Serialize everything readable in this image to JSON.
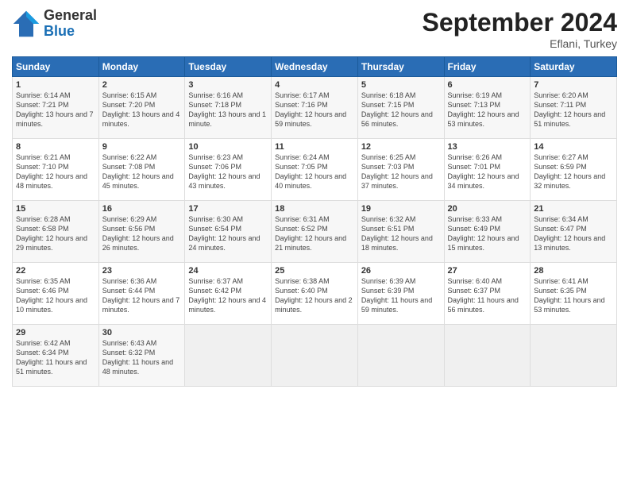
{
  "logo": {
    "general": "General",
    "blue": "Blue"
  },
  "title": "September 2024",
  "location": "Eflani, Turkey",
  "days_of_week": [
    "Sunday",
    "Monday",
    "Tuesday",
    "Wednesday",
    "Thursday",
    "Friday",
    "Saturday"
  ],
  "weeks": [
    [
      {
        "day": "1",
        "sunrise": "6:14 AM",
        "sunset": "7:21 PM",
        "daylight": "13 hours and 7 minutes."
      },
      {
        "day": "2",
        "sunrise": "6:15 AM",
        "sunset": "7:20 PM",
        "daylight": "13 hours and 4 minutes."
      },
      {
        "day": "3",
        "sunrise": "6:16 AM",
        "sunset": "7:18 PM",
        "daylight": "13 hours and 1 minute."
      },
      {
        "day": "4",
        "sunrise": "6:17 AM",
        "sunset": "7:16 PM",
        "daylight": "12 hours and 59 minutes."
      },
      {
        "day": "5",
        "sunrise": "6:18 AM",
        "sunset": "7:15 PM",
        "daylight": "12 hours and 56 minutes."
      },
      {
        "day": "6",
        "sunrise": "6:19 AM",
        "sunset": "7:13 PM",
        "daylight": "12 hours and 53 minutes."
      },
      {
        "day": "7",
        "sunrise": "6:20 AM",
        "sunset": "7:11 PM",
        "daylight": "12 hours and 51 minutes."
      }
    ],
    [
      {
        "day": "8",
        "sunrise": "6:21 AM",
        "sunset": "7:10 PM",
        "daylight": "12 hours and 48 minutes."
      },
      {
        "day": "9",
        "sunrise": "6:22 AM",
        "sunset": "7:08 PM",
        "daylight": "12 hours and 45 minutes."
      },
      {
        "day": "10",
        "sunrise": "6:23 AM",
        "sunset": "7:06 PM",
        "daylight": "12 hours and 43 minutes."
      },
      {
        "day": "11",
        "sunrise": "6:24 AM",
        "sunset": "7:05 PM",
        "daylight": "12 hours and 40 minutes."
      },
      {
        "day": "12",
        "sunrise": "6:25 AM",
        "sunset": "7:03 PM",
        "daylight": "12 hours and 37 minutes."
      },
      {
        "day": "13",
        "sunrise": "6:26 AM",
        "sunset": "7:01 PM",
        "daylight": "12 hours and 34 minutes."
      },
      {
        "day": "14",
        "sunrise": "6:27 AM",
        "sunset": "6:59 PM",
        "daylight": "12 hours and 32 minutes."
      }
    ],
    [
      {
        "day": "15",
        "sunrise": "6:28 AM",
        "sunset": "6:58 PM",
        "daylight": "12 hours and 29 minutes."
      },
      {
        "day": "16",
        "sunrise": "6:29 AM",
        "sunset": "6:56 PM",
        "daylight": "12 hours and 26 minutes."
      },
      {
        "day": "17",
        "sunrise": "6:30 AM",
        "sunset": "6:54 PM",
        "daylight": "12 hours and 24 minutes."
      },
      {
        "day": "18",
        "sunrise": "6:31 AM",
        "sunset": "6:52 PM",
        "daylight": "12 hours and 21 minutes."
      },
      {
        "day": "19",
        "sunrise": "6:32 AM",
        "sunset": "6:51 PM",
        "daylight": "12 hours and 18 minutes."
      },
      {
        "day": "20",
        "sunrise": "6:33 AM",
        "sunset": "6:49 PM",
        "daylight": "12 hours and 15 minutes."
      },
      {
        "day": "21",
        "sunrise": "6:34 AM",
        "sunset": "6:47 PM",
        "daylight": "12 hours and 13 minutes."
      }
    ],
    [
      {
        "day": "22",
        "sunrise": "6:35 AM",
        "sunset": "6:46 PM",
        "daylight": "12 hours and 10 minutes."
      },
      {
        "day": "23",
        "sunrise": "6:36 AM",
        "sunset": "6:44 PM",
        "daylight": "12 hours and 7 minutes."
      },
      {
        "day": "24",
        "sunrise": "6:37 AM",
        "sunset": "6:42 PM",
        "daylight": "12 hours and 4 minutes."
      },
      {
        "day": "25",
        "sunrise": "6:38 AM",
        "sunset": "6:40 PM",
        "daylight": "12 hours and 2 minutes."
      },
      {
        "day": "26",
        "sunrise": "6:39 AM",
        "sunset": "6:39 PM",
        "daylight": "11 hours and 59 minutes."
      },
      {
        "day": "27",
        "sunrise": "6:40 AM",
        "sunset": "6:37 PM",
        "daylight": "11 hours and 56 minutes."
      },
      {
        "day": "28",
        "sunrise": "6:41 AM",
        "sunset": "6:35 PM",
        "daylight": "11 hours and 53 minutes."
      }
    ],
    [
      {
        "day": "29",
        "sunrise": "6:42 AM",
        "sunset": "6:34 PM",
        "daylight": "11 hours and 51 minutes."
      },
      {
        "day": "30",
        "sunrise": "6:43 AM",
        "sunset": "6:32 PM",
        "daylight": "11 hours and 48 minutes."
      },
      null,
      null,
      null,
      null,
      null
    ]
  ]
}
